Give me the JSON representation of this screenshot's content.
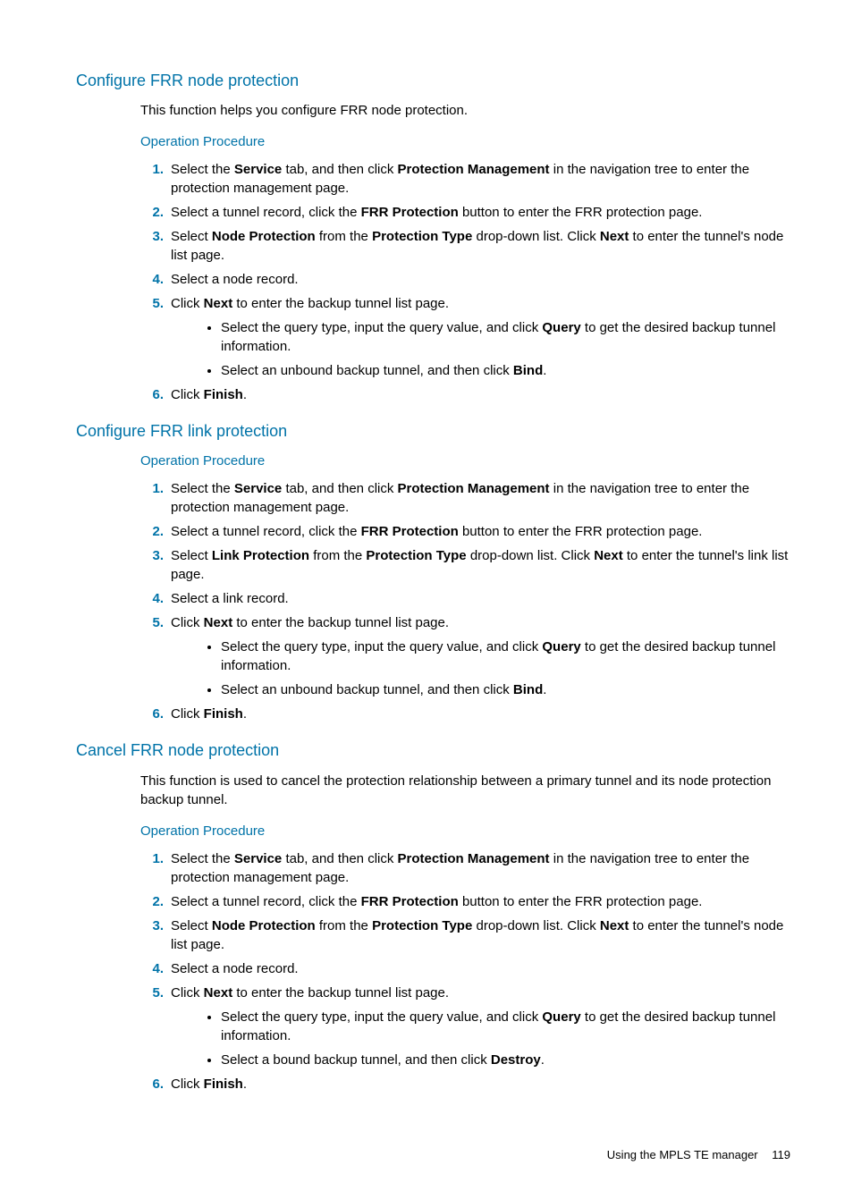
{
  "sections": [
    {
      "heading": "Configure FRR node protection",
      "intro": "This function helps you configure FRR node protection.",
      "procedure_label": "Operation Procedure",
      "steps": [
        {
          "html": "Select the <b>Service</b> tab, and then click <b>Protection Management</b> in the navigation tree to enter the protection management page."
        },
        {
          "html": "Select a tunnel record, click the <b>FRR Protection</b> button to enter the FRR protection page."
        },
        {
          "html": "Select <b>Node Protection</b> from the <b>Protection Type</b> drop-down list. Click <b>Next</b> to enter the tunnel's node list page."
        },
        {
          "html": "Select a node record."
        },
        {
          "html": "Click <b>Next</b> to enter the backup tunnel list page.",
          "bullets": [
            "Select the query type, input the query value, and click <b>Query</b> to get the desired backup tunnel information.",
            "Select an unbound backup tunnel, and then click <b>Bind</b>."
          ]
        },
        {
          "html": "Click <b>Finish</b>."
        }
      ]
    },
    {
      "heading": "Configure FRR link protection",
      "procedure_label": "Operation Procedure",
      "steps": [
        {
          "html": "Select the <b>Service</b> tab, and then click <b>Protection Management</b> in the navigation tree to enter the protection management page."
        },
        {
          "html": "Select a tunnel record, click the <b>FRR Protection</b> button to enter the FRR protection page."
        },
        {
          "html": "Select <b>Link Protection</b> from the <b>Protection Type</b> drop-down list. Click <b>Next</b> to enter the tunnel's link list page."
        },
        {
          "html": "Select a link record."
        },
        {
          "html": "Click <b>Next</b> to enter the backup tunnel list page.",
          "bullets": [
            "Select the query type, input the query value, and click <b>Query</b> to get the desired backup tunnel information.",
            "Select an unbound backup tunnel, and then click <b>Bind</b>."
          ]
        },
        {
          "html": "Click <b>Finish</b>."
        }
      ]
    },
    {
      "heading": "Cancel FRR node protection",
      "intro": "This function is used to cancel the protection relationship between a primary tunnel and its node protection backup tunnel.",
      "procedure_label": "Operation Procedure",
      "steps": [
        {
          "html": "Select the <b>Service</b> tab, and then click <b>Protection Management</b> in the navigation tree to enter the protection management page."
        },
        {
          "html": "Select a tunnel record, click the <b>FRR Protection</b> button to enter the FRR protection page."
        },
        {
          "html": "Select <b>Node Protection</b> from the <b>Protection Type</b> drop-down list. Click <b>Next</b> to enter the tunnel's node list page."
        },
        {
          "html": "Select a node record."
        },
        {
          "html": "Click <b>Next</b> to enter the backup tunnel list page.",
          "bullets": [
            "Select the query type, input the query value, and click <b>Query</b> to get the desired backup tunnel information.",
            "Select a bound backup tunnel, and then click <b>Destroy</b>."
          ]
        },
        {
          "html": "Click <b>Finish</b>."
        }
      ]
    }
  ],
  "footer": {
    "text": "Using the MPLS TE manager",
    "page": "119"
  }
}
